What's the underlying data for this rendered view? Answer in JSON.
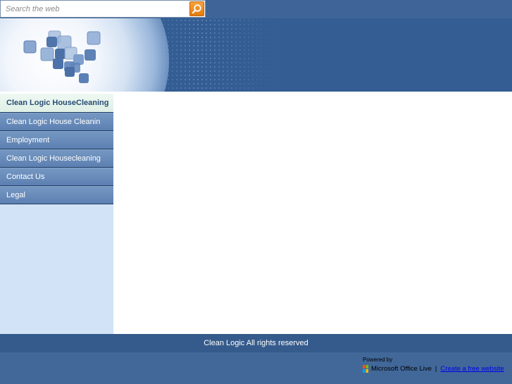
{
  "search": {
    "placeholder": "Search the web",
    "button_icon": "search-icon"
  },
  "banner": {
    "logo_icon": "tiled-squares-logo"
  },
  "sidebar": {
    "items": [
      {
        "label": "Clean Logic HouseCleaning",
        "active": true
      },
      {
        "label": "Clean Logic House Cleanin",
        "active": false
      },
      {
        "label": "Employment",
        "active": false
      },
      {
        "label": "Clean Logic Housecleaning",
        "active": false
      },
      {
        "label": "Contact Us",
        "active": false
      },
      {
        "label": "Legal",
        "active": false
      }
    ]
  },
  "footer": {
    "copyright": "Clean Logic  All rights reserved",
    "powered_by": "Powered by",
    "ms_logo_icon": "office-logo-icon",
    "ms_label": "Microsoft Office Live",
    "separator": "|",
    "free_site_link": "Create a free website"
  },
  "colors": {
    "page_bg": "#416899",
    "banner_bg": "#335d93",
    "sidebar_bg": "#d2e3f7",
    "nav_item_bg": "#5c80b2",
    "nav_active_bg": "#dff0e6",
    "nav_active_text": "#274b73",
    "footer_bar_bg": "#355b8c",
    "search_button_accent": "#e57a0f",
    "link": "#0000ee"
  }
}
